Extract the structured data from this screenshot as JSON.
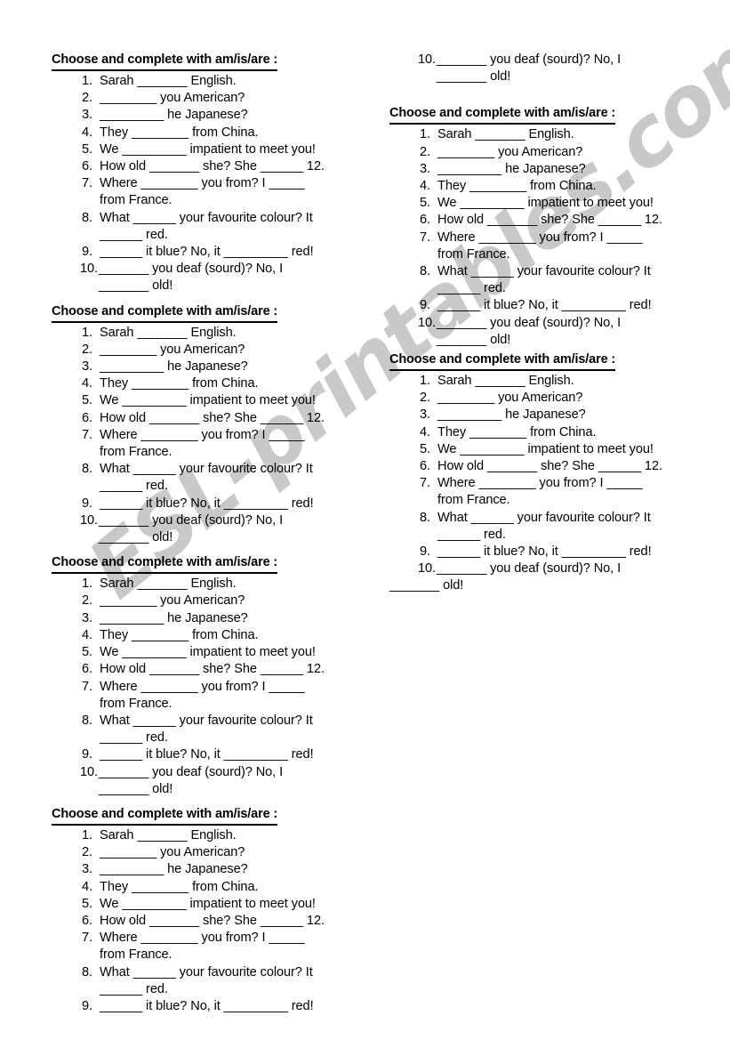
{
  "document": {
    "type": "esl-worksheet",
    "watermark": "ESL-printables.com",
    "watermark_color": "#c9c9c9",
    "page_background": "#ffffff",
    "text_color": "#000000"
  },
  "exercise": {
    "heading": "Choose and complete with am/is/are :",
    "items": [
      {
        "number": "1.",
        "text": "Sarah _______ English."
      },
      {
        "number": "2.",
        "text": "________ you American?"
      },
      {
        "number": "3.",
        "text": "_________ he Japanese?"
      },
      {
        "number": "4.",
        "text": "They ________ from China."
      },
      {
        "number": "5.",
        "text": "We _________ impatient to meet you!"
      },
      {
        "number": "6.",
        "text": "How old _______ she? She ______ 12."
      },
      {
        "number": "7.",
        "text": "Where ________ you from? I _____\nfrom France."
      },
      {
        "number": "8.",
        "text": "What ______ your favourite colour? It\n______ red."
      },
      {
        "number": "9.",
        "text": "______ it blue? No, it _________ red!"
      },
      {
        "number": "10.",
        "text": "_______ you deaf (sourd)? No, I\n_______ old!"
      }
    ],
    "continuation_old": "_______ old!"
  },
  "blocks": {
    "left_column": [
      {
        "id": "block-1",
        "label": "exercise-block-1",
        "items_shown": "1-10"
      },
      {
        "id": "block-2",
        "label": "exercise-block-2",
        "items_shown": "1-10"
      },
      {
        "id": "block-3",
        "label": "exercise-block-3",
        "items_shown": "1-10"
      },
      {
        "id": "block-4",
        "label": "exercise-block-4",
        "items_shown": "1-9"
      }
    ],
    "right_column": [
      {
        "id": "block-4-cont",
        "label": "exercise-block-4-continued",
        "items_shown": "10"
      },
      {
        "id": "block-5",
        "label": "exercise-block-5",
        "items_shown": "1-10"
      },
      {
        "id": "block-6",
        "label": "exercise-block-6",
        "items_shown": "1-10"
      }
    ]
  }
}
